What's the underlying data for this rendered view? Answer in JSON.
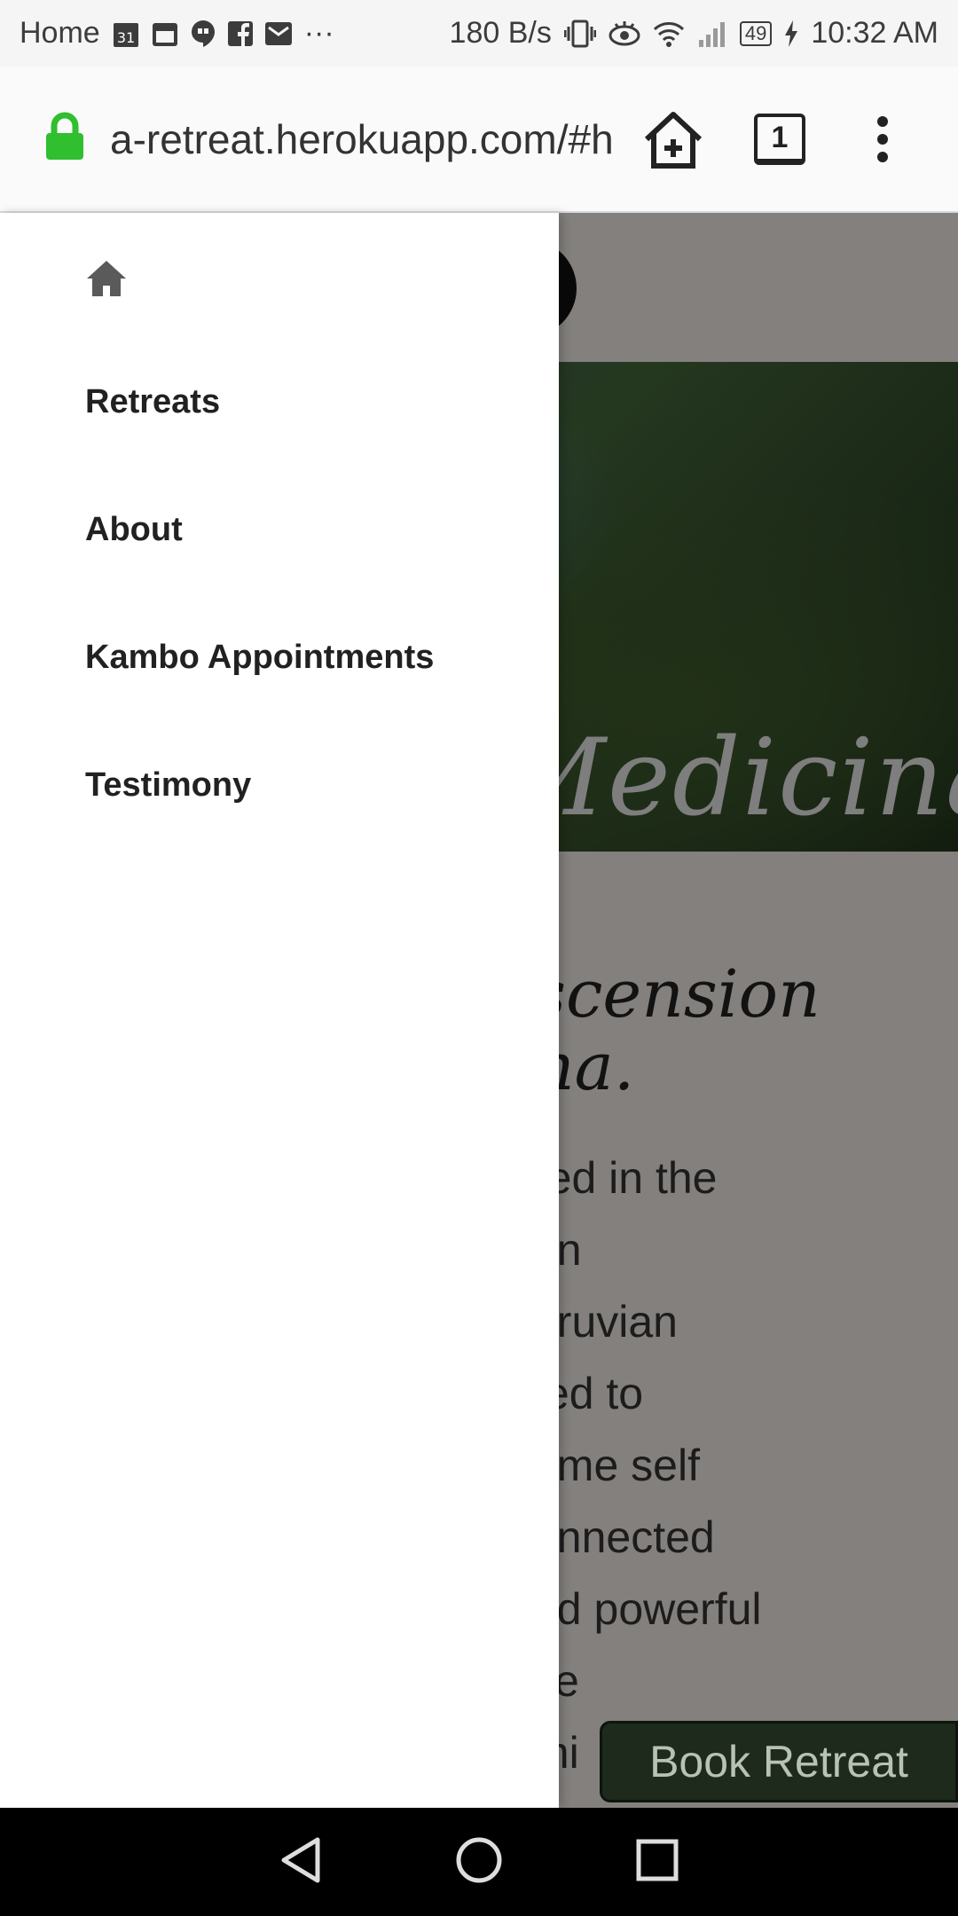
{
  "status_bar": {
    "left_label": "Home",
    "calendar_day": "31",
    "more": "···",
    "net_speed": "180 B/s",
    "battery": "49",
    "time": "10:32 AM"
  },
  "browser": {
    "url": "a-retreat.herokuapp.com/#h",
    "tab_count": "1"
  },
  "drawer": {
    "items": [
      {
        "label": "Retreats"
      },
      {
        "label": "About"
      },
      {
        "label": "Kambo Appointments"
      },
      {
        "label": "Testimony"
      }
    ]
  },
  "page": {
    "hero_title": "Medicina",
    "headline_line1": "scension",
    "headline_line2": "na.",
    "body_lines": [
      "red in the",
      "on",
      "eruvian",
      "ted to",
      "ome self",
      "onnected",
      "nd powerful",
      "ve",
      "mi"
    ],
    "book_button": "Book Retreat"
  },
  "colors": {
    "lock_green": "#2fbf2f",
    "drawer_bg": "#ffffff",
    "overlay": "#7a7a7a"
  }
}
